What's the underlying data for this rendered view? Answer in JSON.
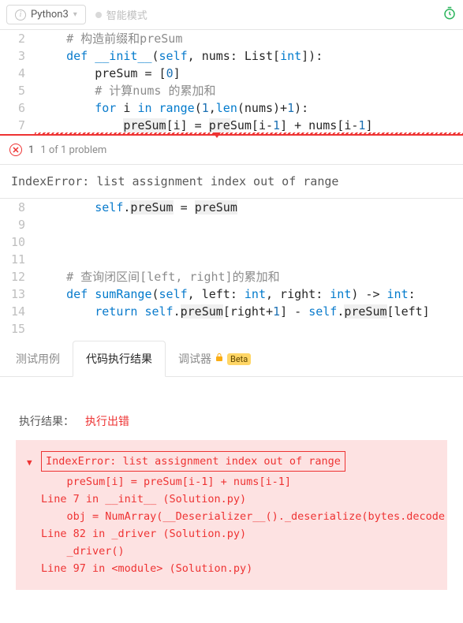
{
  "header": {
    "language": "Python3",
    "smart_mode": "智能模式"
  },
  "code": {
    "lines": [
      {
        "n": 2,
        "html": "<span class='c'># 构造前缀和preSum</span>"
      },
      {
        "n": 3,
        "html": "<span class='kw'>def</span> <span class='fn'>__init__</span>(<span class='kw'>self</span>, nums: List[<span class='bi'>int</span>]):"
      },
      {
        "n": 4,
        "html": "    preSum = [<span class='nm'>0</span>]"
      },
      {
        "n": 5,
        "html": "    <span class='c'># 计算nums 的累加和</span>"
      },
      {
        "n": 6,
        "html": "    <span class='kw'>for</span> i <span class='kw'>in</span> <span class='bi'>range</span>(<span class='nm'>1</span>,<span class='bi'>len</span>(nums)+<span class='nm'>1</span>):"
      },
      {
        "n": 7,
        "html": "        <span class='hl'>preSum</span>[i] = <span class='hl'>pre</span>Sum[i-<span class='nm'>1</span>] + nums[i-<span class='nm'>1</span>]",
        "err": true
      }
    ],
    "lines2": [
      {
        "n": 8,
        "html": "    <span class='kw'>self</span>.<span class='hl'>preSum</span> = <span class='hl'>preSum</span>"
      },
      {
        "n": 9,
        "html": ""
      },
      {
        "n": 10,
        "html": ""
      },
      {
        "n": 11,
        "html": ""
      },
      {
        "n": 12,
        "html": "<span class='c'># 查询闭区间[left, right]的累加和</span>"
      },
      {
        "n": 13,
        "html": "<span class='kw'>def</span> <span class='fn'>sumRange</span>(<span class='kw'>self</span>, left: <span class='bi'>int</span>, right: <span class='bi'>int</span>) -> <span class='bi'>int</span>:"
      },
      {
        "n": 14,
        "html": "    <span class='kw'>return</span> <span class='kw'>self</span>.<span class='hl'>preSum</span>[right+<span class='nm'>1</span>] - <span class='kw'>self</span>.<span class='hl'>preSum</span>[left]"
      },
      {
        "n": 15,
        "html": ""
      }
    ]
  },
  "problems": {
    "count": "1",
    "summary": "1 of 1 problem",
    "message": "IndexError: list assignment index out of range"
  },
  "tabs": {
    "test_cases": "测试用例",
    "result": "代码执行结果",
    "debugger": "调试器",
    "beta": "Beta"
  },
  "result": {
    "label": "执行结果：",
    "status": "执行出错",
    "trace": {
      "main": "IndexError: list assignment index out of range",
      "lines": [
        "    preSum[i] = preSum[i-1] + nums[i-1]",
        "Line 7 in __init__ (Solution.py)",
        "    obj = NumArray(__Deserializer__()._deserialize(bytes.decode",
        "Line 82 in _driver (Solution.py)",
        "    _driver()",
        "Line 97 in <module> (Solution.py)"
      ]
    }
  }
}
